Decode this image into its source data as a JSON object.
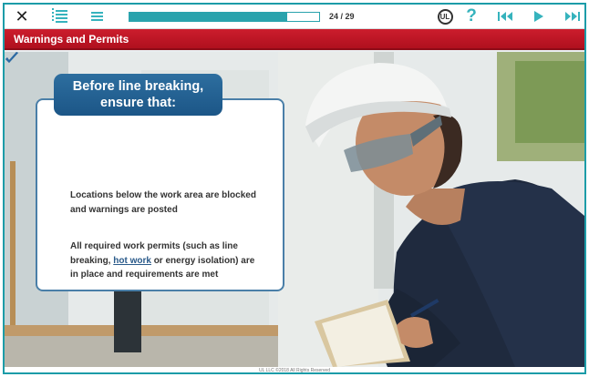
{
  "toolbar": {
    "close_icon": "close-icon",
    "progress_percent": 83,
    "page_counter": "24 / 29",
    "ul_logo_text": "UL",
    "help_label": "?"
  },
  "title": "Warnings and Permits",
  "card": {
    "header": "Before line breaking, ensure that:",
    "item1": "Locations below the work area are blocked and warnings are posted",
    "item2_before": "All required work permits (such as line breaking, ",
    "item2_link": "hot work",
    "item2_after": " or energy isolation) are in place and requirements are met"
  },
  "footer": "UL LLC ©2018 All Rights Reserved",
  "colors": {
    "accent": "#1c9ca8",
    "title_bar": "#c0172a",
    "card_header": "#245f92",
    "check": "#2d6aa3"
  }
}
